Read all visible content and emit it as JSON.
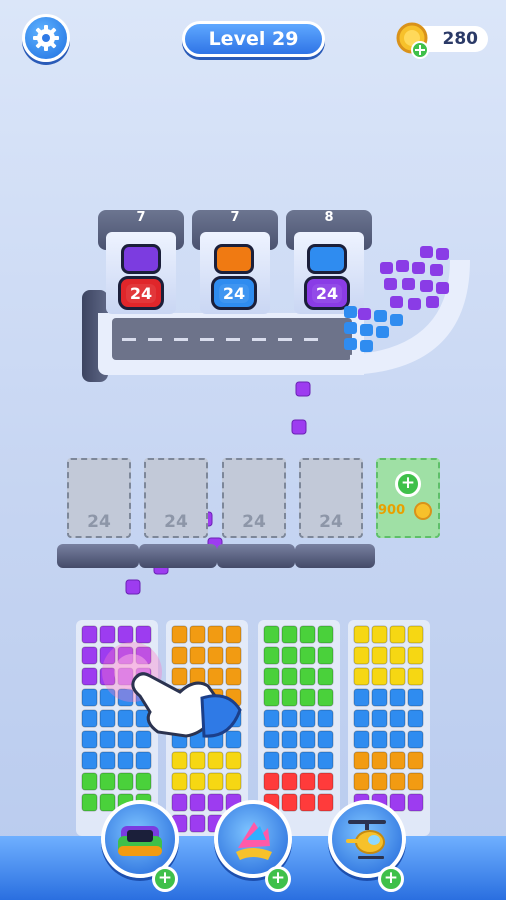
{
  "header": {
    "level_label": "Level 29",
    "coins": "280"
  },
  "conveyor": {
    "slots": [
      {
        "count": "7",
        "bin_color": "#7c3ce0",
        "bin_value": "24",
        "box_color": "#e0262a"
      },
      {
        "count": "7",
        "bin_color": "#f07a12",
        "bin_value": "24",
        "box_color": "#2f8cf0"
      },
      {
        "count": "8",
        "bin_color": "#2f8cf0",
        "bin_value": "24",
        "box_color": "#8a3ce6"
      }
    ]
  },
  "holding_bins": [
    {
      "capacity": "24"
    },
    {
      "capacity": "24"
    },
    {
      "capacity": "24"
    },
    {
      "capacity": "24"
    }
  ],
  "locked_bin": {
    "cost": "900"
  },
  "stacks": [
    {
      "colors": [
        "#9d3cf0",
        "#9d3cf0",
        "#9d3cf0",
        "#2f8cf0",
        "#2f8cf0",
        "#2f8cf0",
        "#2f8cf0",
        "#4ad13b",
        "#4ad13b"
      ]
    },
    {
      "colors": [
        "#f29b12",
        "#f29b12",
        "#f29b12",
        "#f29b12",
        "#2f8cf0",
        "#2f8cf0",
        "#f6d713",
        "#f6d713",
        "#9d3cf0",
        "#9d3cf0"
      ]
    },
    {
      "colors": [
        "#4ad13b",
        "#4ad13b",
        "#4ad13b",
        "#4ad13b",
        "#2f8cf0",
        "#2f8cf0",
        "#2f8cf0",
        "#ff3b3b",
        "#ff3b3b"
      ]
    },
    {
      "colors": [
        "#f6d713",
        "#f6d713",
        "#f6d713",
        "#2f8cf0",
        "#2f8cf0",
        "#2f8cf0",
        "#f29b12",
        "#f29b12",
        "#9d3cf0"
      ]
    }
  ],
  "boosters": [
    {
      "name": "add-bin"
    },
    {
      "name": "shuffle"
    },
    {
      "name": "helicopter"
    }
  ],
  "icons": {
    "settings": "gear-icon",
    "coin": "coin-icon",
    "plus": "plus-icon",
    "hand": "pointer-hand-icon"
  }
}
